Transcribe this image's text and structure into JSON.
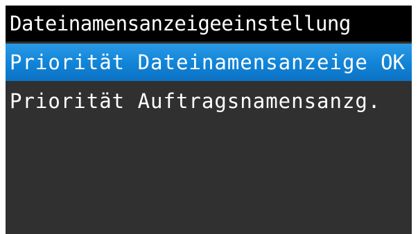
{
  "screen": {
    "title": "Dateinamensanzeigeeinstellung",
    "items": [
      {
        "label": "Priorität Dateinamensanzeige",
        "status": "OK",
        "selected": true
      },
      {
        "label": "Priorität Auftragsnamensanzg.",
        "status": "",
        "selected": false
      }
    ]
  },
  "colors": {
    "title_bar": "#000000",
    "screen_background": "#303030",
    "selection": "#1a8ee0",
    "text": "#ffffff"
  }
}
